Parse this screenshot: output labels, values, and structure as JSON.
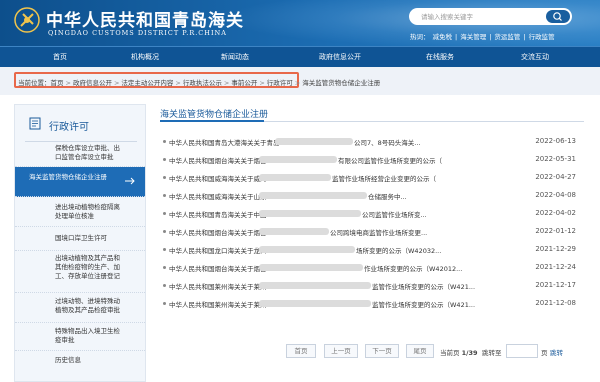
{
  "header": {
    "title_cn": "中华人民共和国青岛海关",
    "title_en": "QINGDAO CUSTOMS DISTRICT P.R.CHINA",
    "search_placeholder": "请输入搜索关键字",
    "hot_label": "热词：",
    "hot_words": [
      "减免税",
      "|",
      "海关管理",
      "|",
      "货运监管",
      "|",
      "行政监管"
    ]
  },
  "nav": {
    "items": [
      "首页",
      "机构概况",
      "新闻动态",
      "政府信息公开",
      "在线服务",
      "交流互动"
    ]
  },
  "breadcrumb": {
    "items": [
      "当前位置：首页",
      "政府信息公开",
      "法定主动公开内容",
      "行政执法公示",
      "事前公开",
      "行政许可",
      "海关监管货物仓储企业注册"
    ]
  },
  "sidebar": {
    "heading": "行政许可",
    "items": [
      {
        "label": "保税仓库设立审批、出口监管仓库设立审批",
        "active": false
      },
      {
        "label": "海关监管货物仓储企业注册",
        "active": true
      },
      {
        "label": "进出境动植物检疫隔离处理单位核准",
        "active": false
      },
      {
        "label": "国境口岸卫生许可",
        "active": false
      },
      {
        "label": "出境动植物及其产品和其他检疫物的生产、加工、存放单位注册登记",
        "active": false
      },
      {
        "label": "过境动物、进境特殊动植物及其产品检疫审批",
        "active": false
      },
      {
        "label": "特殊物品出入境卫生检疫审批",
        "active": false
      },
      {
        "label": "历史信息",
        "active": false
      }
    ]
  },
  "main": {
    "title": "海关监管货物仓储企业注册",
    "rows": [
      {
        "pre": "中华人民共和国青岛大港海关关于青岛",
        "post": "公司7、8号码头海关...",
        "date": "2022-06-13"
      },
      {
        "pre": "中华人民共和国烟台海关关于烟台",
        "post": "有限公司监管作业场所变更的公示（",
        "date": "2022-05-31"
      },
      {
        "pre": "中华人民共和国威海海关关于威海",
        "post": "监管作业场所经营企业变更的公示（",
        "date": "2022-04-27"
      },
      {
        "pre": "中华人民共和国威海海关关于山东",
        "post": "仓储服务中...",
        "date": "2022-04-08"
      },
      {
        "pre": "中华人民共和国青岛海关关于中国",
        "post": "公司监管作业场所变...",
        "date": "2022-04-02"
      },
      {
        "pre": "中华人民共和国烟台海关关于烟台",
        "post": "公司跨境电商监管作业场所变更...",
        "date": "2022-01-12"
      },
      {
        "pre": "中华人民共和国龙口海关关于龙口",
        "post": "场所变更的公示（W42032...",
        "date": "2021-12-29"
      },
      {
        "pre": "中华人民共和国烟台海关关于烟台",
        "post": "作业场所变更的公示（W42012...",
        "date": "2021-12-24"
      },
      {
        "pre": "中华人民共和国莱州海关关于莱州",
        "post": "监管作业场所变更的公示（W421...",
        "date": "2021-12-17"
      },
      {
        "pre": "中华人民共和国莱州海关关于莱州",
        "post": "监管作业场所变更的公示（W421...",
        "date": "2021-12-08"
      }
    ]
  },
  "pager": {
    "first": "首页",
    "prev": "上一页",
    "next": "下一页",
    "last": "尾页",
    "current_label": "当前页",
    "current": "1/39",
    "goto_label": "跳转至",
    "page_suffix": "页",
    "go": "跳转"
  },
  "colors": {
    "header_bg": "#1c6db3",
    "nav_bg": "#0f5495",
    "accent": "#1e6cb6",
    "breadcrumb_highlight": "#e8684a"
  }
}
